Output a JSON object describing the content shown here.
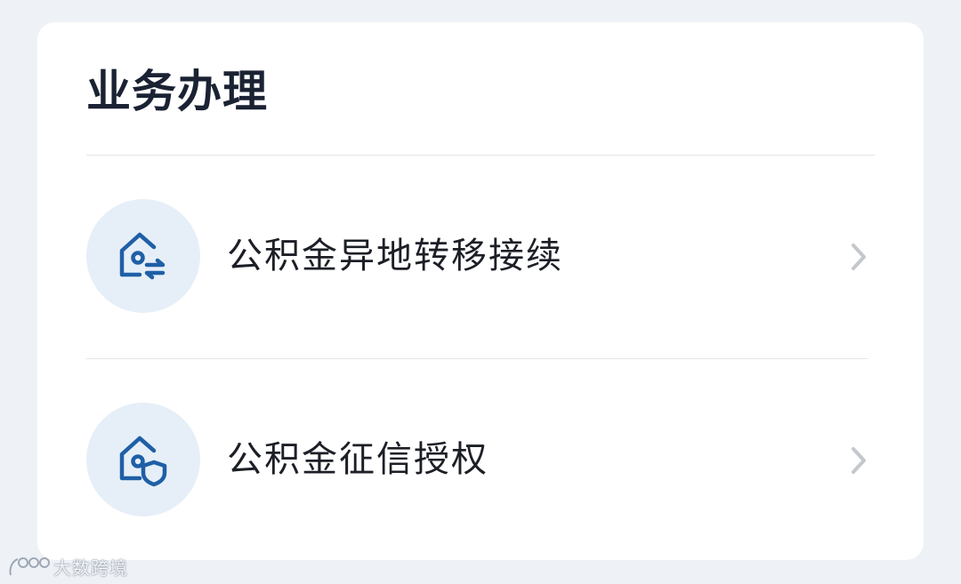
{
  "card": {
    "title": "业务办理"
  },
  "items": [
    {
      "label": "公积金异地转移接续",
      "icon": "house-transfer-icon"
    },
    {
      "label": "公积金征信授权",
      "icon": "house-shield-icon"
    }
  ],
  "watermark": {
    "text": "大数跨境"
  },
  "colors": {
    "background": "#eef2f7",
    "card": "#ffffff",
    "icon_circle": "#e6eff8",
    "icon_stroke": "#1f5fa6",
    "title_text": "#1a2233",
    "chevron": "#c4c7cc"
  }
}
